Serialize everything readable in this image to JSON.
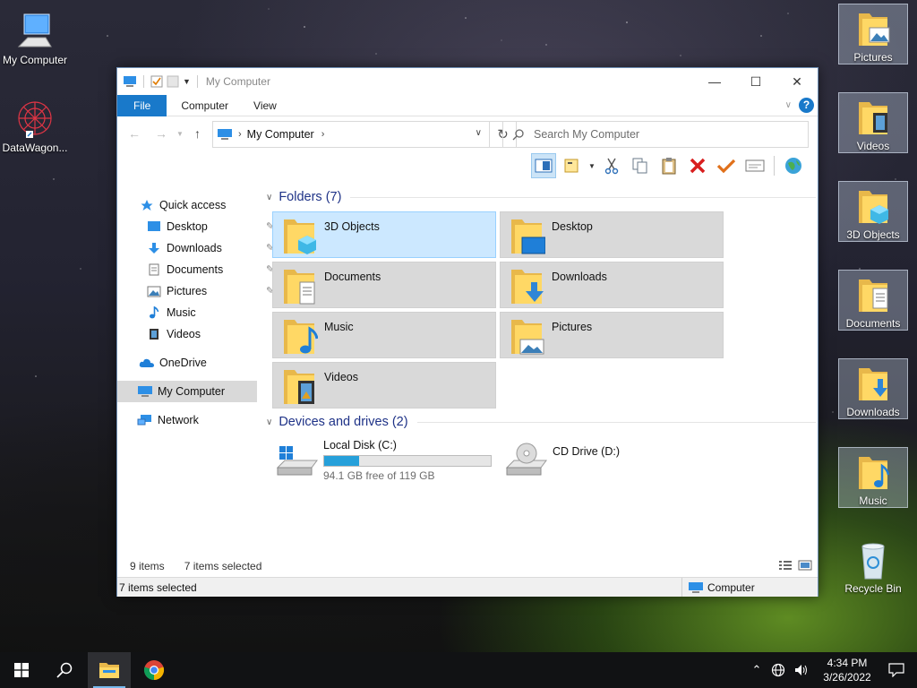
{
  "desktop": {
    "left_icons": [
      {
        "label": "My Computer",
        "icon": "computer-icon"
      },
      {
        "label": "DataWagon...",
        "icon": "datawagon-icon"
      }
    ],
    "right_icons": [
      {
        "label": "Pictures",
        "icon": "pictures-folder-icon"
      },
      {
        "label": "Videos",
        "icon": "videos-folder-icon"
      },
      {
        "label": "3D Objects",
        "icon": "3d-objects-folder-icon"
      },
      {
        "label": "Documents",
        "icon": "documents-folder-icon"
      },
      {
        "label": "Downloads",
        "icon": "downloads-folder-icon"
      },
      {
        "label": "Music",
        "icon": "music-folder-icon"
      },
      {
        "label": "Recycle Bin",
        "icon": "recycle-bin-icon"
      }
    ]
  },
  "window": {
    "title": "My Computer",
    "ribbon_tabs": [
      "File",
      "Computer",
      "View"
    ],
    "help": "?",
    "address": {
      "crumb": "My Computer"
    },
    "search": {
      "placeholder": "Search My Computer"
    },
    "nav": {
      "quick_access": "Quick access",
      "pinned": [
        "Desktop",
        "Downloads",
        "Documents",
        "Pictures"
      ],
      "unpinned": [
        "Music",
        "Videos"
      ],
      "onedrive": "OneDrive",
      "my_computer": "My Computer",
      "network": "Network"
    },
    "folders_header": "Folders (7)",
    "folders": [
      "3D Objects",
      "Desktop",
      "Documents",
      "Downloads",
      "Music",
      "Pictures",
      "Videos"
    ],
    "devices_header": "Devices and drives (2)",
    "drives": [
      {
        "name": "Local Disk (C:)",
        "free": "94.1 GB free of 119 GB",
        "used_fraction": 0.21
      },
      {
        "name": "CD Drive (D:)"
      }
    ],
    "status": {
      "items": "9 items",
      "selected": "7 items selected"
    },
    "statusbar": {
      "left": "7 items selected",
      "right": "Computer"
    }
  },
  "taskbar": {
    "clock_time": "4:34 PM",
    "clock_date": "3/26/2022"
  },
  "colors": {
    "accent": "#1979ca",
    "selection": "#cce8ff",
    "header_text": "#1e3287",
    "drive_fill": "#26a0da"
  }
}
